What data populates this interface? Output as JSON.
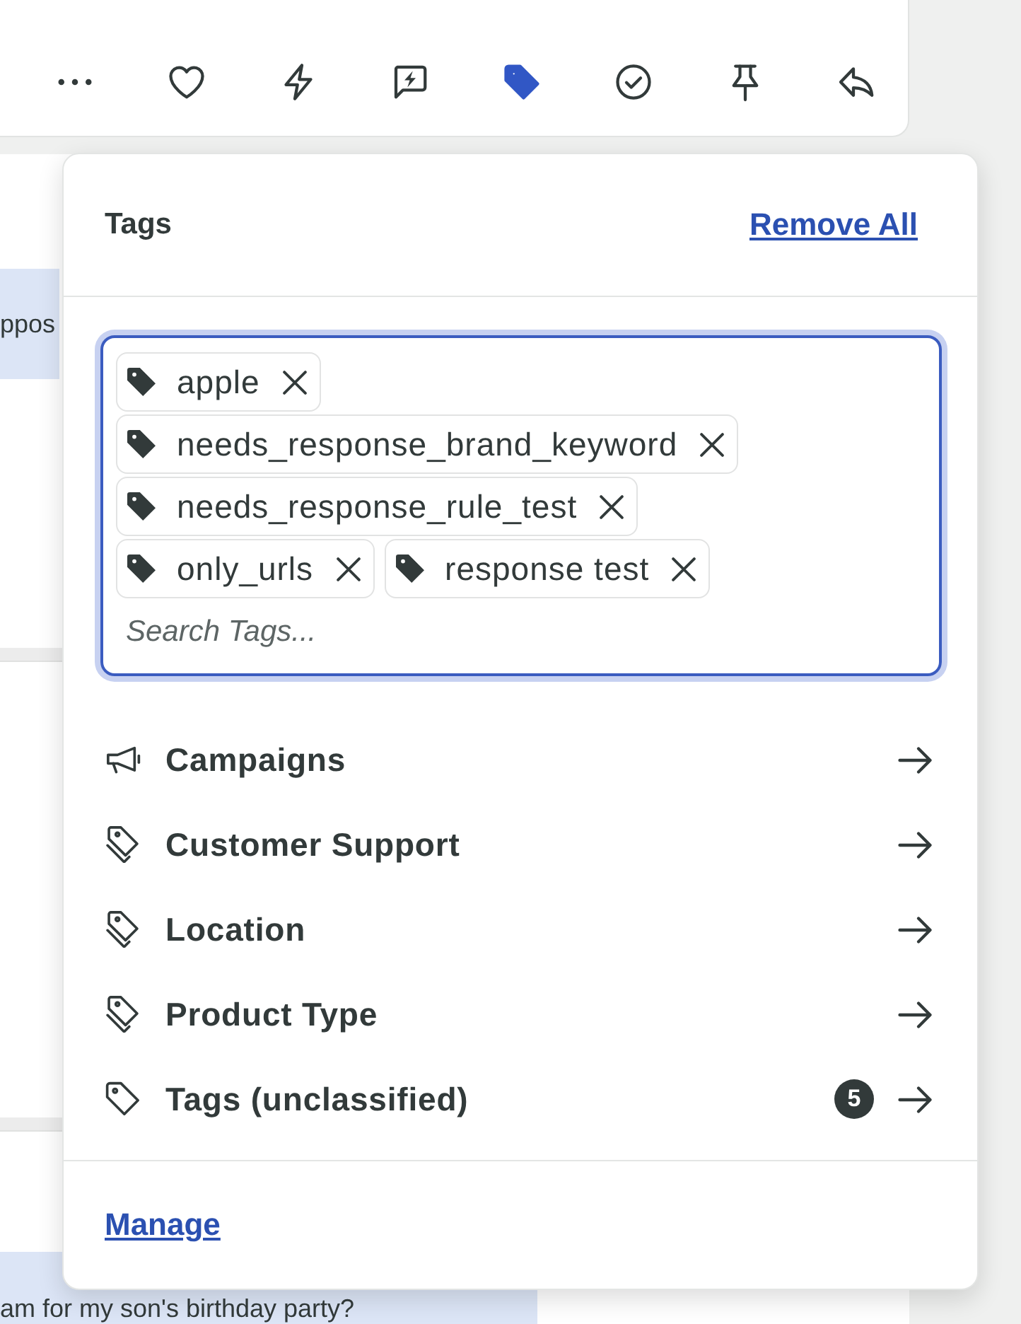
{
  "toolbar": {
    "buttons": [
      {
        "kind": "more",
        "selected": false
      },
      {
        "kind": "heart",
        "selected": false
      },
      {
        "kind": "bolt",
        "selected": false
      },
      {
        "kind": "chat_bolt",
        "selected": false
      },
      {
        "kind": "tag",
        "selected": true
      },
      {
        "kind": "check",
        "selected": false
      },
      {
        "kind": "pin",
        "selected": false
      },
      {
        "kind": "reply",
        "selected": false
      }
    ]
  },
  "conversation": {
    "messages": [
      {
        "text": "ppos"
      },
      {
        "text": "am for my son's birthday party?"
      }
    ]
  },
  "tags_popover": {
    "title": "Tags",
    "remove_all": "Remove All",
    "tag_input": {
      "focused": true,
      "tags": [
        {
          "label": "apple"
        },
        {
          "label": "needs_response_brand_keyword"
        },
        {
          "label": "needs_response_rule_test"
        },
        {
          "label": "only_urls"
        },
        {
          "label": "response test"
        }
      ],
      "placeholder": "Search Tags..."
    },
    "categories": [
      {
        "kind": "megaphone",
        "label": "Campaigns"
      },
      {
        "kind": "tag_group",
        "label": "Customer Support"
      },
      {
        "kind": "tag_group",
        "label": "Location"
      },
      {
        "kind": "tag_group",
        "label": "Product Type"
      },
      {
        "kind": "tag",
        "label": "Tags (unclassified)",
        "count": "5"
      }
    ],
    "manage": "Manage"
  }
}
